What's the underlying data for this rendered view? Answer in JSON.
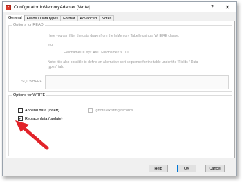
{
  "window": {
    "title": "Configurator InMemoryAdapter [Write]",
    "app_icon_glyph": "▪",
    "help_glyph": "?",
    "close_glyph": "✕"
  },
  "tabs": [
    {
      "label": "General",
      "active": true
    },
    {
      "label": "Fields / Data types",
      "active": false
    },
    {
      "label": "Format",
      "active": false
    },
    {
      "label": "Advanced",
      "active": false
    },
    {
      "label": "Notes",
      "active": false
    }
  ],
  "read_options": {
    "title": "Options for READ",
    "line1": "Here you can filter the data drawn from the InMemory Tabelle using a WHERE clause.",
    "line2": "e.g.",
    "line3": "Fieldname1 = 'xyz' AND Fieldname2 > 100",
    "line4": "Note: it is also possible to define an alternative sort sequence for the table under the \"Fields / Data",
    "line5": "types\" tab.",
    "sql_where_label": "SQL WHERE",
    "sql_where_value": ""
  },
  "write_options": {
    "title": "Options for WRITE",
    "append_label": "Append data (insert)",
    "append_checked": false,
    "ignore_label": "Ignore existing records",
    "ignore_checked": false,
    "replace_label": "Replace data (update)",
    "replace_checked": true,
    "check_glyph": "✓"
  },
  "buttons": {
    "help": "Help",
    "ok": "OK",
    "cancel": "Cancel"
  },
  "colors": {
    "arrow": "#e2232a",
    "default_button_border": "#0078d7"
  }
}
